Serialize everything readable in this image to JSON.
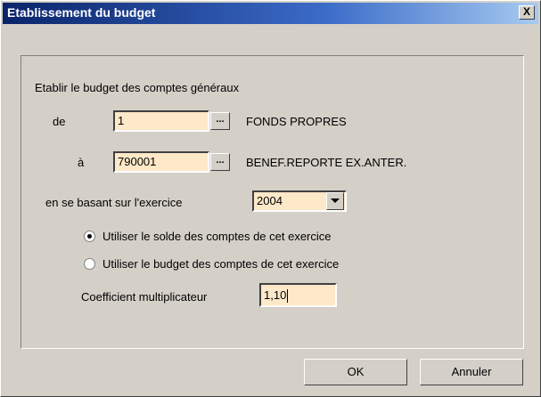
{
  "window": {
    "title": "Etablissement du budget",
    "close_glyph": "X"
  },
  "group": {
    "heading": "Etablir le budget des comptes généraux"
  },
  "range": {
    "from_label": "de",
    "from_value": "1",
    "from_description": "FONDS PROPRES",
    "to_label": "à",
    "to_value": "790001",
    "to_description": "BENEF.REPORTE EX.ANTER.",
    "browse_glyph": "..."
  },
  "exercise": {
    "label": "en se basant sur l'exercice",
    "selected": "2004"
  },
  "options": [
    {
      "label": "Utiliser le solde des comptes de cet exercice",
      "checked": true
    },
    {
      "label": "Utiliser le budget des comptes de cet exercice",
      "checked": false
    }
  ],
  "coefficient": {
    "label": "Coefficient multiplicateur",
    "value": "1,10"
  },
  "buttons": {
    "ok": "OK",
    "cancel": "Annuler"
  },
  "colors": {
    "field_bg": "#fde8c8",
    "title_bar": "#0a246a",
    "dialog_bg": "#d4d0c8"
  }
}
